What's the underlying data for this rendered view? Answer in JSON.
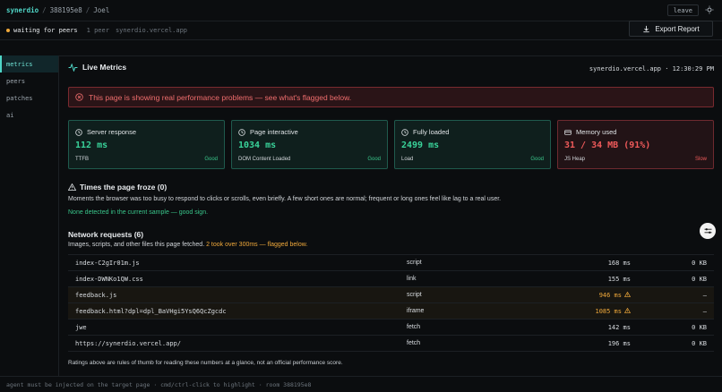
{
  "topbar": {
    "brand": "synerdio",
    "separator": "/",
    "room_id": "388195e8",
    "user": "Joel",
    "leave_label": "leave",
    "theme_icon": "sun-icon"
  },
  "statusbar": {
    "status": "waiting for peers",
    "peers": "1 peer",
    "host": "synerdio.vercel.app",
    "export_label": "Export Report",
    "status_color": "#f0a93b"
  },
  "sidebar": {
    "items": [
      {
        "label": "metrics",
        "active": true
      },
      {
        "label": "peers",
        "active": false
      },
      {
        "label": "patches",
        "active": false
      },
      {
        "label": "ai",
        "active": false
      }
    ]
  },
  "main": {
    "title": "Live Metrics",
    "meta": "synerdio.vercel.app · 12:30:29 PM",
    "alert": "This page is showing real performance problems — see what's flagged below.",
    "cards": [
      {
        "title": "Server response",
        "icon": "clock-icon",
        "value": "112 ms",
        "sub": "TTFB",
        "status": "Good"
      },
      {
        "title": "Page interactive",
        "icon": "clock-icon",
        "value": "1034 ms",
        "sub": "DOM Content Loaded",
        "status": "Good"
      },
      {
        "title": "Fully loaded",
        "icon": "clock-icon",
        "value": "2499 ms",
        "sub": "Load",
        "status": "Good"
      },
      {
        "title": "Memory used",
        "icon": "memory-icon",
        "value": "31 / 34 MB (91%)",
        "sub": "JS Heap",
        "status": "Slow"
      }
    ],
    "freeze": {
      "title": "Times the page froze (0)",
      "desc": "Moments the browser was too busy to respond to clicks or scrolls, even briefly. A few short ones are normal; frequent or long ones feel like lag to a real user.",
      "result": "None detected in the current sample — good sign."
    },
    "network": {
      "title": "Network requests (6)",
      "desc_prefix": "Images, scripts, and other files this page fetched.",
      "desc_flag": "2 took over 300ms — flagged below.",
      "rows": [
        {
          "name": "index-C2gIr01m.js",
          "type": "script",
          "time": "168 ms",
          "size": "0 KB",
          "slow": false
        },
        {
          "name": "index-DWNKo1QW.css",
          "type": "link",
          "time": "155 ms",
          "size": "0 KB",
          "slow": false
        },
        {
          "name": "feedback.js",
          "type": "script",
          "time": "946 ms",
          "size": "—",
          "slow": true
        },
        {
          "name": "feedback.html?dpl=dpl_BaVHgi5YsQ6QcZgcdc",
          "type": "iframe",
          "time": "1085 ms",
          "size": "—",
          "slow": true
        },
        {
          "name": "jwe",
          "type": "fetch",
          "time": "142 ms",
          "size": "0 KB",
          "slow": false
        },
        {
          "name": "https://synerdio.vercel.app/",
          "type": "fetch",
          "time": "196 ms",
          "size": "0 KB",
          "slow": false
        }
      ]
    },
    "footer_note": "Ratings above are rules of thumb for reading these numbers at a glance, not an official performance score."
  },
  "bottombar": {
    "text": "agent must be injected on the target page · cmd/ctrl-click to highlight · room 388195e8"
  },
  "colors": {
    "accent": "#4fd6c7",
    "good": "#39d39a",
    "bad": "#ef5a5a",
    "warn": "#f0a93b",
    "background": "#0b0d0f"
  }
}
